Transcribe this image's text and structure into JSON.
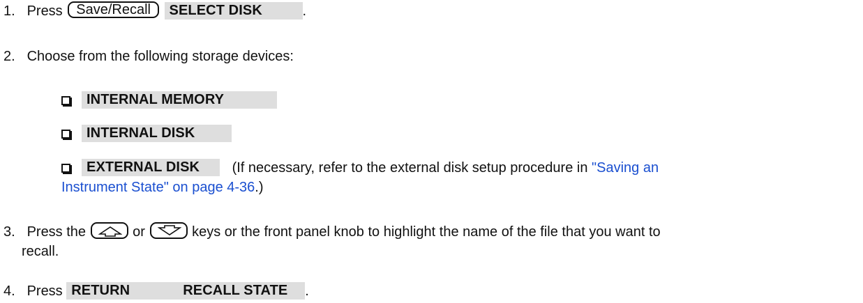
{
  "steps": [
    {
      "number": "1.",
      "prefix": "Press",
      "hardkey": "Save/Recall",
      "softkey": "SELECT DISK",
      "suffix": "."
    },
    {
      "number": "2.",
      "text": "Choose from the following storage devices:",
      "options": [
        {
          "softkey": "INTERNAL MEMORY"
        },
        {
          "softkey": "INTERNAL DISK"
        },
        {
          "softkey": "EXTERNAL DISK",
          "note_before_link": "(If necessary, refer to the external disk setup procedure in ",
          "link_line1": "\"Saving an",
          "link_line2": "Instrument State\" on page 4-36",
          "note_after_link": ".)"
        }
      ]
    },
    {
      "number": "3.",
      "prefix": "Press the",
      "middle": "or",
      "text_line1": "keys or the front panel knob to highlight the name of the file that you want to",
      "text_line2": "recall.",
      "up_key_icon": "up-arrow-icon",
      "down_key_icon": "down-arrow-icon"
    },
    {
      "number": "4.",
      "prefix": "Press",
      "softkey1": "RETURN",
      "softkey2": "RECALL STATE",
      "suffix": "."
    }
  ],
  "colors": {
    "text": "#111111",
    "softkey_background": "#dedede",
    "link": "#1a4fd0"
  }
}
